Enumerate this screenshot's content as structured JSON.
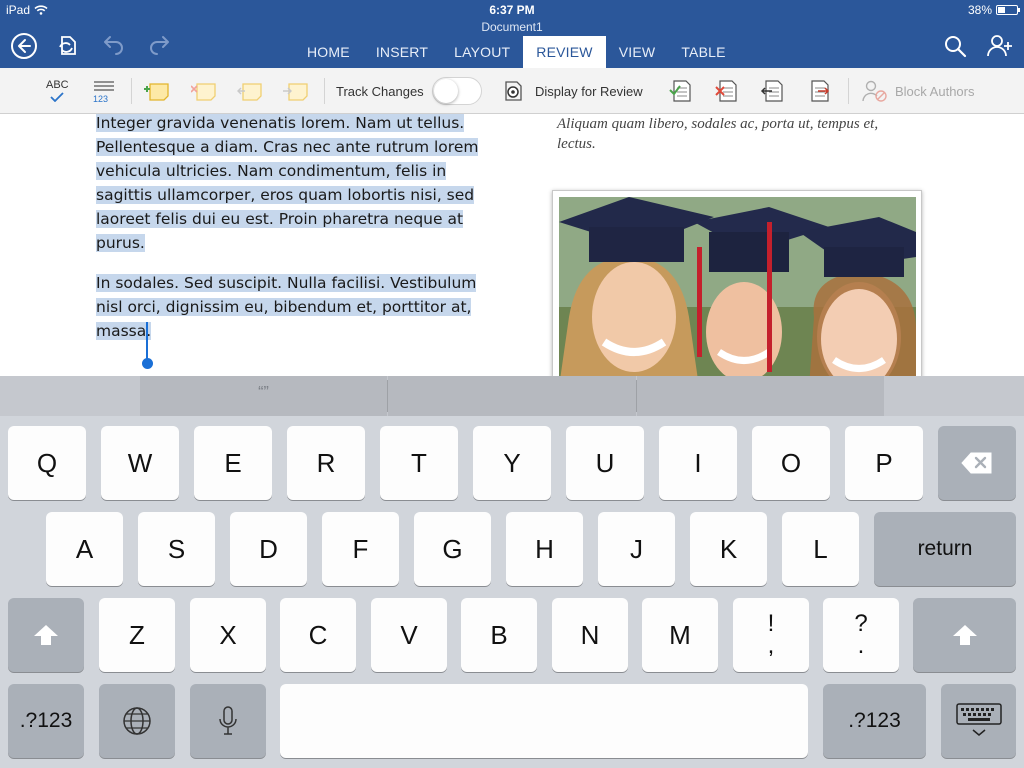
{
  "status_bar": {
    "carrier": "iPad",
    "time": "6:37 PM",
    "battery_percent": "38%",
    "battery_level": 0.38
  },
  "document_title": "Document1",
  "toolbar": {
    "icons": [
      "back-icon",
      "sync-icon",
      "undo-icon",
      "redo-icon",
      "search-icon",
      "share-person-icon"
    ]
  },
  "tabs": [
    {
      "label": "HOME",
      "active": false
    },
    {
      "label": "INSERT",
      "active": false
    },
    {
      "label": "LAYOUT",
      "active": false
    },
    {
      "label": "REVIEW",
      "active": true
    },
    {
      "label": "VIEW",
      "active": false
    },
    {
      "label": "TABLE",
      "active": false
    }
  ],
  "ribbon": {
    "spelling_icon_label": "ABC",
    "word_count_icon_label": "123",
    "track_changes_label": "Track Changes",
    "track_changes_on": false,
    "display_for_review_label": "Display for Review",
    "block_authors_label": "Block Authors"
  },
  "document": {
    "paragraph1": "Integer gravida venenatis lorem. Nam ut tellus. Pellentesque a diam. Cras nec ante rutrum lorem vehicula ultricies. Nam condimentum, felis in sagittis ullamcorper, eros quam lobortis nisi, sed laoreet felis dui eu est. Proin pharetra neque at purus.",
    "paragraph2": "In sodales. Sed suscipit. Nulla facilisi. Vestibulum nisl orci, dignissim eu, bibendum et, porttitor at, massa.",
    "italic_text": "Aliquam quam libero, sodales ac, porta ut, tempus et, lectus."
  },
  "suggestions": [
    "“”",
    "",
    ""
  ],
  "keyboard": {
    "row1": [
      "Q",
      "W",
      "E",
      "R",
      "T",
      "Y",
      "U",
      "I",
      "O",
      "P"
    ],
    "row2": [
      "A",
      "S",
      "D",
      "F",
      "G",
      "H",
      "J",
      "K",
      "L"
    ],
    "row3": [
      "Z",
      "X",
      "C",
      "V",
      "B",
      "N",
      "M"
    ],
    "punct1": [
      "!",
      ","
    ],
    "punct2": [
      "?",
      "."
    ],
    "return_label": "return",
    "numbers_label": ".?123"
  },
  "colors": {
    "word_blue": "#2b579a",
    "selection": "#c6d7ec",
    "cursor": "#1a6fd6"
  }
}
